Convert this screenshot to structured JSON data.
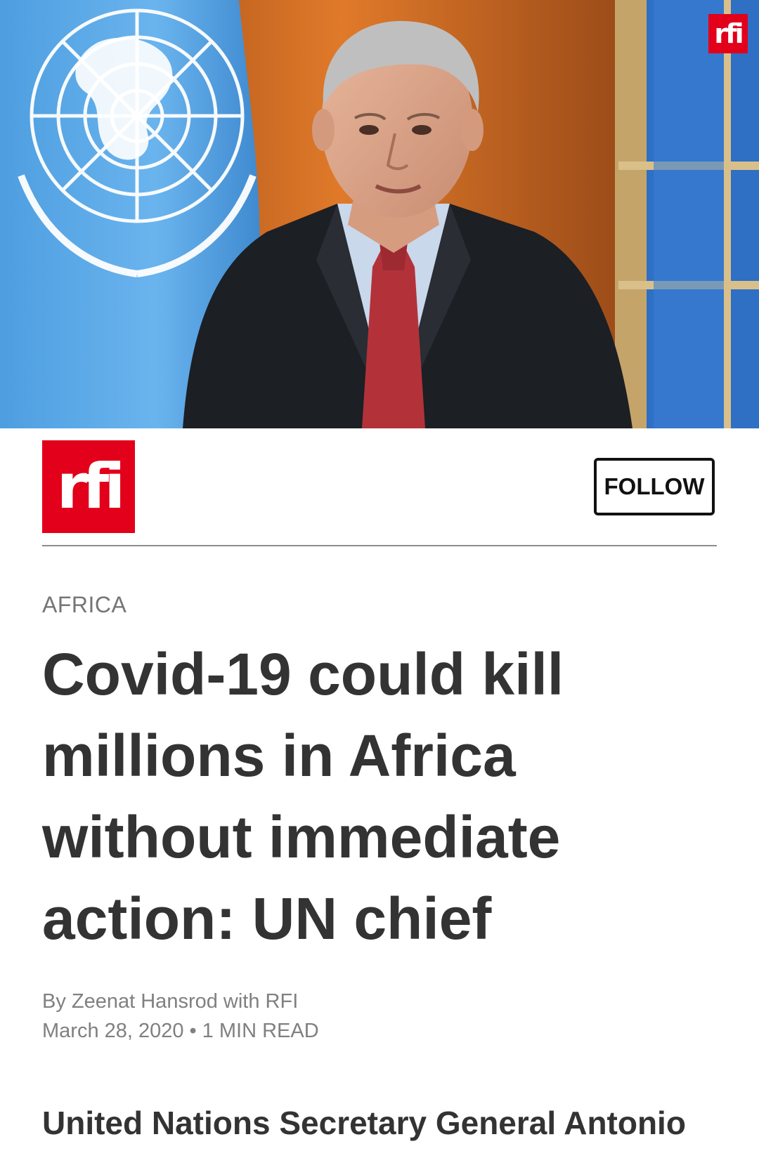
{
  "hero": {
    "logo_text": "rfi",
    "subject": "un-secretary-general-speaking"
  },
  "source": {
    "logo_text": "rfi",
    "follow_label": "FOLLOW"
  },
  "article": {
    "category": "AFRICA",
    "headline": "Covid-19 could kill millions in Africa without immediate action: UN chief",
    "byline": "By Zeenat Hansrod with RFI",
    "date": "March 28, 2020",
    "separator": "•",
    "read_time": "1 MIN READ",
    "lead": "United Nations Secretary General Antonio"
  },
  "colors": {
    "brand_red": "#e2001a",
    "text_dark": "#333333",
    "text_muted": "#808080"
  }
}
